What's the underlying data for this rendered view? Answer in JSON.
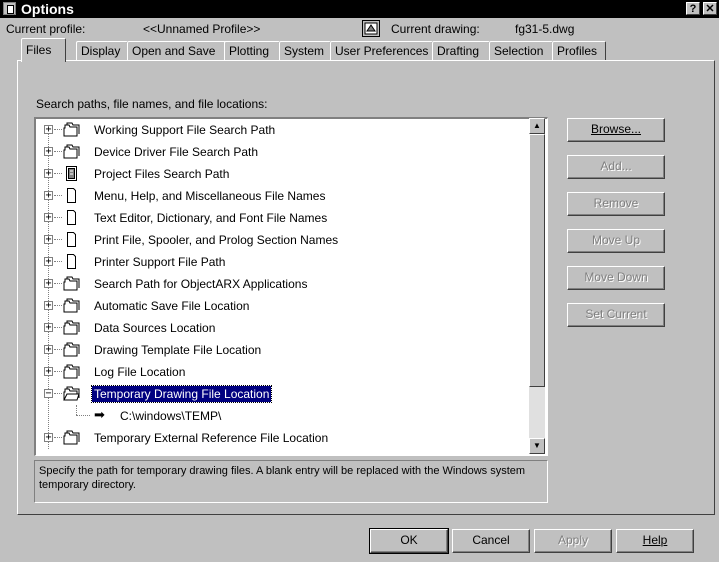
{
  "window": {
    "title": "Options",
    "help_glyph": "?",
    "close_glyph": "✕"
  },
  "profile": {
    "label": "Current profile:",
    "value": "<<Unnamed Profile>>",
    "drawing_label": "Current drawing:",
    "drawing_value": "fg31-5.dwg"
  },
  "tabs": [
    {
      "label": "Files",
      "active": true
    },
    {
      "label": "Display"
    },
    {
      "label": "Open and Save"
    },
    {
      "label": "Plotting"
    },
    {
      "label": "System"
    },
    {
      "label": "User Preferences"
    },
    {
      "label": "Drafting"
    },
    {
      "label": "Selection"
    },
    {
      "label": "Profiles"
    }
  ],
  "files": {
    "section_label": "Search paths, file names, and file locations:",
    "items": [
      {
        "label": "Working Support File Search Path",
        "icon": "folders-icon"
      },
      {
        "label": "Device Driver File Search Path",
        "icon": "folders-icon"
      },
      {
        "label": "Project Files Search Path",
        "icon": "project-files-icon"
      },
      {
        "label": "Menu, Help, and Miscellaneous File Names",
        "icon": "file-icon"
      },
      {
        "label": "Text Editor, Dictionary, and Font File Names",
        "icon": "file-icon"
      },
      {
        "label": "Print File, Spooler, and Prolog Section Names",
        "icon": "file-icon"
      },
      {
        "label": "Printer Support File Path",
        "icon": "file-icon"
      },
      {
        "label": "Search Path for ObjectARX Applications",
        "icon": "folders-icon"
      },
      {
        "label": "Automatic Save File Location",
        "icon": "folders-icon"
      },
      {
        "label": "Data Sources Location",
        "icon": "folders-icon"
      },
      {
        "label": "Drawing Template File Location",
        "icon": "folders-icon"
      },
      {
        "label": "Log File Location",
        "icon": "folders-icon"
      },
      {
        "label": "Temporary Drawing File Location",
        "icon": "folders-icon",
        "expanded": true,
        "selected": true
      },
      {
        "label": "Temporary External Reference File Location",
        "icon": "folders-icon"
      }
    ],
    "expanded_child": "C:\\windows\\TEMP\\",
    "description": "Specify the path for temporary drawing files. A blank entry will be replaced with the Windows system temporary directory."
  },
  "side_buttons": {
    "browse": "Browse...",
    "add": "Add...",
    "remove": "Remove",
    "move_up": "Move Up",
    "move_down": "Move Down",
    "set_current": "Set Current"
  },
  "bottom_buttons": {
    "ok": "OK",
    "cancel": "Cancel",
    "apply": "Apply",
    "help": "Help"
  },
  "colors": {
    "face": "#c0c0c0",
    "selection": "#000080",
    "titlebar": "#000000"
  }
}
